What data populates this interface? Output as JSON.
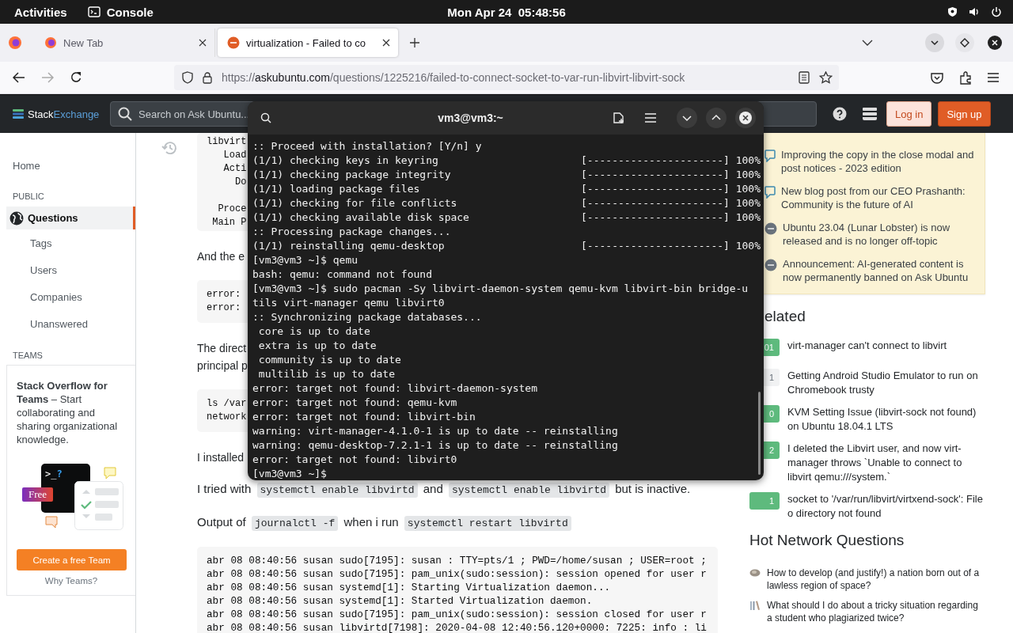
{
  "top_bar": {
    "activities": "Activities",
    "app": "Console",
    "clock": "Mon Apr 24  05:48:56"
  },
  "browser": {
    "tabs": [
      {
        "title": "New Tab",
        "selected": false,
        "kind": "firefox"
      },
      {
        "title": "virtualization - Failed to co",
        "selected": true,
        "kind": "ask"
      }
    ],
    "address": {
      "scheme": "https://",
      "domain": "askubuntu.com",
      "path": "/questions/1225216/failed-to-connect-socket-to-var-run-libvirt-libvirt-sock"
    }
  },
  "site_header": {
    "logo_first": "Stack",
    "logo_second": "Exchange",
    "search": {
      "placeholder": "Search on Ask Ubuntu..."
    },
    "login": "Log in",
    "signup": "Sign up"
  },
  "sidebar": {
    "home": {
      "label": "Home",
      "selected": false
    },
    "public_heading": "PUBLIC",
    "questions": {
      "label": "Questions",
      "selected": true,
      "children": [
        {
          "label": "Tags",
          "selected": false
        },
        {
          "label": "Users",
          "selected": false
        },
        {
          "label": "Companies",
          "selected": false
        },
        {
          "label": "Unanswered",
          "selected": false
        }
      ]
    },
    "teams_heading": "TEAMS",
    "teams_card": {
      "text": "**Stack Overflow for Teams** – Start collaborating and sharing organizational knowledge.",
      "prompt_symbol": ">_",
      "prompt_mark": "?",
      "badge": "Free",
      "button": "Create a free Team",
      "link": "Why Teams?"
    }
  },
  "content": {
    "blocks": [
      {
        "kind": "code",
        "segments": [
          [
            "libvirt",
            "   Load",
            "   Acti",
            "     Do"
          ],
          [
            "  Proce",
            " Main P"
          ]
        ]
      },
      {
        "kind": "text",
        "lines": [
          "And the e"
        ]
      },
      {
        "kind": "code",
        "lines": [
          "error:",
          "error:"
        ]
      },
      {
        "kind": "text",
        "lines": [
          "The direct",
          "principal p"
        ]
      },
      {
        "kind": "code",
        "lines": [
          "ls /var",
          "network"
        ]
      },
      {
        "kind": "text",
        "lines": [
          "I installed"
        ]
      },
      {
        "kind": "mixed",
        "parts": [
          {
            "kind": "text",
            "text": "I tried with "
          },
          {
            "kind": "code",
            "text": "systemctl enable libvirtd"
          },
          {
            "kind": "text",
            "text": " and "
          },
          {
            "kind": "code",
            "text": "systemctl enable libvirtd"
          },
          {
            "kind": "text",
            "text": " but is inactive."
          }
        ]
      },
      {
        "kind": "mixed",
        "parts": [
          {
            "kind": "text",
            "text": "Output of "
          },
          {
            "kind": "code",
            "text": "journalctl -f"
          },
          {
            "kind": "text",
            "text": " when i run "
          },
          {
            "kind": "code",
            "text": "systemctl restart libvirtd"
          }
        ]
      },
      {
        "kind": "log",
        "lines": [
          "abr 08 08:40:56 susan sudo[7195]: susan : TTY=pts/1 ; PWD=/home/susan ; USER=root ;",
          "abr 08 08:40:56 susan sudo[7195]: pam_unix(sudo:session): session opened for user r",
          "abr 08 08:40:56 susan systemd[1]: Starting Virtualization daemon...",
          "abr 08 08:40:56 susan systemd[1]: Started Virtualization daemon.",
          "abr 08 08:40:56 susan sudo[7195]: pam_unix(sudo:session): session closed for user r",
          "abr 08 08:40:56 susan libvirtd[7198]: 2020-04-08 12:40:56.120+0000: 7225: info : li"
        ]
      }
    ]
  },
  "right_sidebar": {
    "featured": [
      {
        "kind": "blog",
        "text": "Improving the copy in the close modal and post notices - 2023 edition"
      },
      {
        "kind": "blog",
        "text": "New blog post from our CEO Prashanth: Community is the future of AI"
      },
      {
        "kind": "meta",
        "text": "Ubuntu 23.04 (Lunar Lobster) is now released and is no longer off-topic"
      },
      {
        "kind": "meta",
        "text": "Announcement: AI-generated content is now permanently banned on Ask Ubuntu"
      }
    ],
    "related_heading": "elated",
    "related": [
      {
        "score": "01",
        "accepted": true,
        "title": "virt-manager can't connect to libvirt"
      },
      {
        "score": "1",
        "accepted": false,
        "title": "Getting Android Studio Emulator to run on Chromebook trusty"
      },
      {
        "score": "0",
        "accepted": true,
        "title": "KVM Setting Issue (libvirt-sock not found) on Ubuntu 18.04.1 LTS"
      },
      {
        "score": "2",
        "accepted": true,
        "title": "I deleted the Libvirt user, and now virt-manager throws `Unable to connect to libvirt qemu:///system.`"
      },
      {
        "score": "1",
        "accepted": true,
        "title": "socket to '/var/run/libvirt/virtxend-sock': File o directory not found"
      }
    ],
    "hot_heading": "Hot Network Questions",
    "hot": [
      {
        "kind": "planet",
        "text": "How to develop (and justify!) a nation born out of a lawless region of space?"
      },
      {
        "kind": "books",
        "text": "What should I do about a tricky situation regarding a student who plagiarized twice?"
      }
    ]
  },
  "terminal": {
    "title": "vm3@vm3:~",
    "lines": [
      {
        "text": ":: Proceed with installation? [Y/n] y"
      },
      {
        "text": "(1/1) checking keys in keyring",
        "progress": "[----------------------] 100%"
      },
      {
        "text": "(1/1) checking package integrity",
        "progress": "[----------------------] 100%"
      },
      {
        "text": "(1/1) loading package files",
        "progress": "[----------------------] 100%"
      },
      {
        "text": "(1/1) checking for file conflicts",
        "progress": "[----------------------] 100%"
      },
      {
        "text": "(1/1) checking available disk space",
        "progress": "[----------------------] 100%"
      },
      {
        "text": ":: Processing package changes..."
      },
      {
        "text": "(1/1) reinstalling qemu-desktop",
        "progress": "[----------------------] 100%"
      },
      {
        "text": "[vm3@vm3 ~]$ qemu"
      },
      {
        "text": "bash: qemu: command not found"
      },
      {
        "text": "[vm3@vm3 ~]$ sudo pacman -Sy libvirt-daemon-system qemu-kvm libvirt-bin bridge-u"
      },
      {
        "text": "tils virt-manager qemu libvirt0"
      },
      {
        "text": ":: Synchronizing package databases..."
      },
      {
        "text": " core is up to date"
      },
      {
        "text": " extra is up to date"
      },
      {
        "text": " community is up to date"
      },
      {
        "text": " multilib is up to date"
      },
      {
        "text": "error: target not found: libvirt-daemon-system"
      },
      {
        "text": "error: target not found: qemu-kvm"
      },
      {
        "text": "error: target not found: libvirt-bin"
      },
      {
        "text": "warning: virt-manager-4.1.0-1 is up to date -- reinstalling"
      },
      {
        "text": "warning: qemu-desktop-7.2.1-1 is up to date -- reinstalling"
      },
      {
        "text": "error: target not found: libvirt0"
      },
      {
        "text": "[vm3@vm3 ~]$"
      }
    ]
  }
}
